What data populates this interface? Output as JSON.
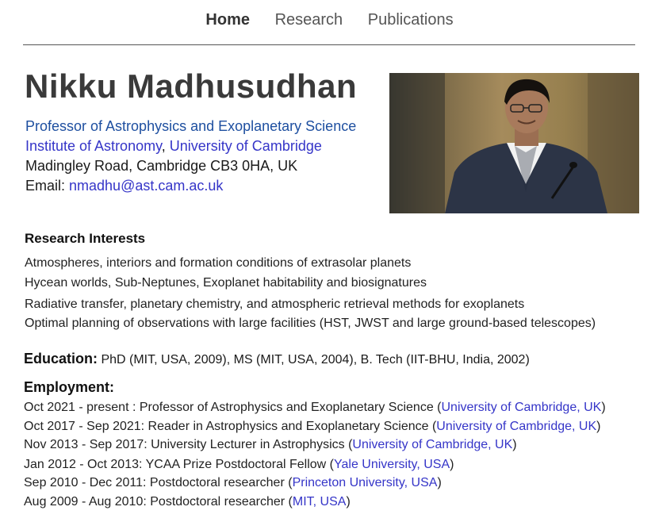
{
  "nav": {
    "home": "Home",
    "research": "Research",
    "publications": "Publications"
  },
  "profile": {
    "name": "Nikku Madhusudhan",
    "title": "Professor of Astrophysics and Exoplanetary Science",
    "institute": "Institute of Astronomy",
    "separator": ",",
    "university": "University of Cambridge",
    "address": "Madingley Road, Cambridge CB3 0HA, UK",
    "email_label": "Email: ",
    "email": "nmadhu@ast.cam.ac.uk"
  },
  "research": {
    "heading": "Research Interests",
    "items": [
      "Atmospheres, interiors and formation conditions of extrasolar planets",
      "Hycean worlds, Sub-Neptunes, Exoplanet habitability and biosignatures",
      "Radiative transfer, planetary chemistry, and atmospheric retrieval methods for exoplanets",
      "Optimal planning of observations with large facilities (HST, JWST and large ground-based telescopes)"
    ]
  },
  "education": {
    "heading": "Education:",
    "text": " PhD (MIT, USA, 2009), MS (MIT, USA, 2004), B. Tech (IIT-BHU, India, 2002)"
  },
  "employment": {
    "heading": "Employment:",
    "items": [
      {
        "text": "Oct 2021 - present   : Professor of Astrophysics and Exoplanetary Science (",
        "link": "University of Cambridge, UK",
        "close": ")"
      },
      {
        "text": "Oct 2017 - Sep 2021: Reader in Astrophysics and Exoplanetary Science (",
        "link": "University of Cambridge, UK",
        "close": ")"
      },
      {
        "text": "Nov 2013 - Sep 2017: University Lecturer in Astrophysics (",
        "link": "University of Cambridge, UK",
        "close": ")"
      },
      {
        "text": "Jan 2012 - Oct 2013: YCAA Prize Postdoctoral Fellow (",
        "link": "Yale University, USA",
        "close": ")"
      },
      {
        "text": "Sep 2010 - Dec 2011: Postdoctoral researcher (",
        "link": "Princeton University, USA",
        "close": ")"
      },
      {
        "text": "Aug 2009 - Aug 2010: Postdoctoral researcher (",
        "link": "MIT, USA",
        "close": ")"
      }
    ]
  }
}
